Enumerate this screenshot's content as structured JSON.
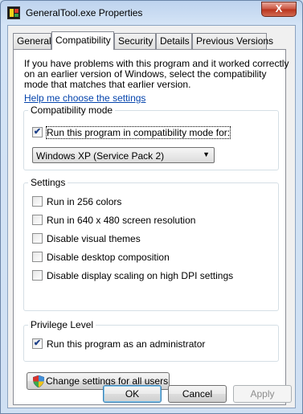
{
  "window": {
    "title": "GeneralTool.exe Properties",
    "close_glyph": "X"
  },
  "tabs": [
    {
      "label": "General"
    },
    {
      "label": "Compatibility"
    },
    {
      "label": "Security"
    },
    {
      "label": "Details"
    },
    {
      "label": "Previous Versions"
    }
  ],
  "intro_text": "If you have problems with this program and it worked correctly on an earlier version of Windows, select the compatibility mode that matches that earlier version.",
  "help_link": "Help me choose the settings",
  "compat_mode": {
    "label": "Compatibility mode",
    "checkbox_label": "Run this program in compatibility mode for:",
    "checked": true,
    "selected_os": "Windows XP (Service Pack 2)"
  },
  "settings": {
    "label": "Settings",
    "items": [
      {
        "label": "Run in 256 colors",
        "checked": false
      },
      {
        "label": "Run in 640 x 480 screen resolution",
        "checked": false
      },
      {
        "label": "Disable visual themes",
        "checked": false
      },
      {
        "label": "Disable desktop composition",
        "checked": false
      },
      {
        "label": "Disable display scaling on high DPI settings",
        "checked": false
      }
    ]
  },
  "privilege": {
    "label": "Privilege Level",
    "checkbox_label": "Run this program as an administrator",
    "checked": true
  },
  "change_all_users_label": "Change settings for all users",
  "buttons": {
    "ok": "OK",
    "cancel": "Cancel",
    "apply": "Apply"
  },
  "check_glyph": "✔",
  "arrow_glyph": "▼"
}
